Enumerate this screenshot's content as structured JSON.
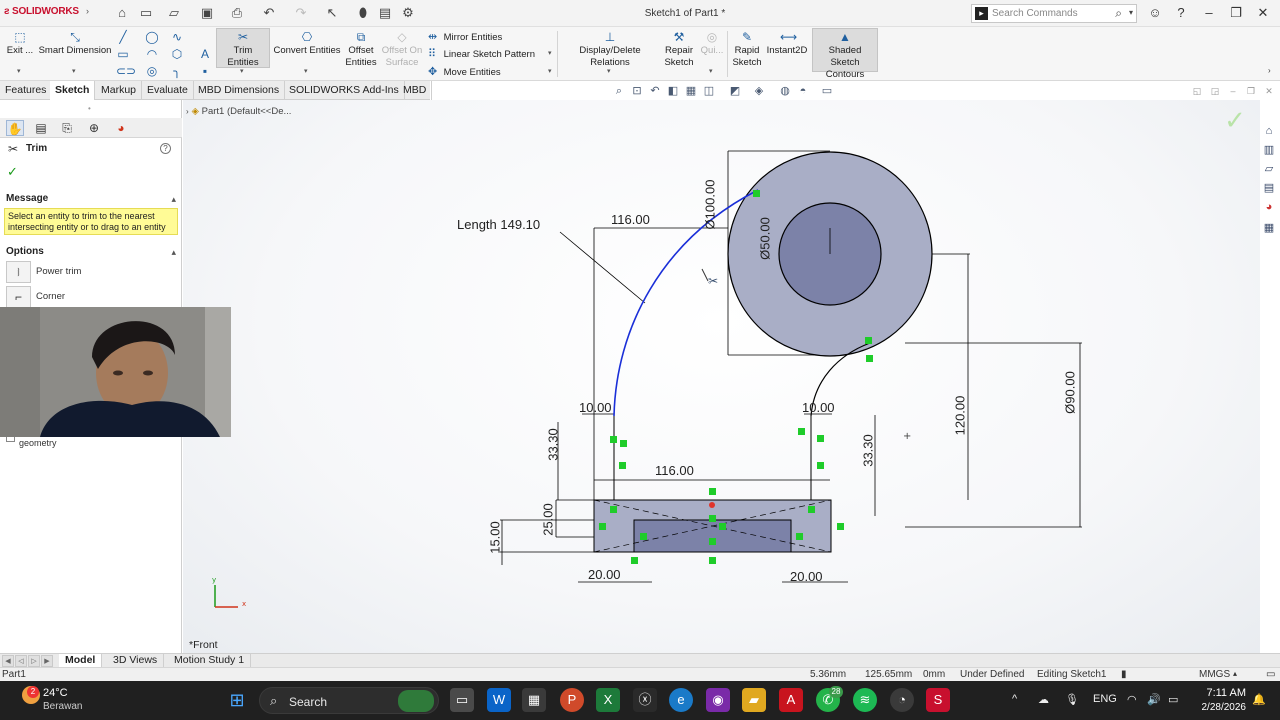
{
  "titlebar": {
    "app_brand": "SOLIDWORKS",
    "document_title": "Sketch1 of Part1 *",
    "search_placeholder": "Search Commands"
  },
  "ribbon": {
    "exit_label": "Exit ...",
    "smart_dimension": "Smart Dimension",
    "trim_entities": "Trim Entities",
    "convert_entities": "Convert Entities",
    "offset_entities_1": "Offset",
    "offset_entities_2": "Entities",
    "offset_on_surface_1": "Offset On",
    "offset_on_surface_2": "Surface",
    "mirror_entities": "Mirror Entities",
    "linear_sketch_pattern": "Linear Sketch Pattern",
    "move_entities": "Move Entities",
    "display_delete_relations": "Display/Delete Relations",
    "repair_sketch_1": "Repair",
    "repair_sketch_2": "Sketch",
    "quick_snaps": "Qui...",
    "rapid_sketch_1": "Rapid",
    "rapid_sketch_2": "Sketch",
    "instant2d": "Instant2D",
    "shaded_contours_1": "Shaded Sketch",
    "shaded_contours_2": "Contours"
  },
  "tabs": [
    "Features",
    "Sketch",
    "Markup",
    "Evaluate",
    "MBD Dimensions",
    "SOLIDWORKS Add-Ins",
    "MBD"
  ],
  "active_tab": "Sketch",
  "property_manager": {
    "title": "Trim",
    "message_header": "Message",
    "message_text": "Select an entity to trim to the nearest intersecting entity or to drag to an entity",
    "options_header": "Options",
    "options": [
      "Power trim",
      "Corner"
    ],
    "partial_label": "geometry"
  },
  "viewport": {
    "tree_item": "Part1 (Default<<De...",
    "view_label": "*Front",
    "dimensions": {
      "length_label": "Length 149.10",
      "top_width": "116.00",
      "dia_100": "Ø100.00",
      "dia_50": "Ø50.00",
      "dia_90": "Ø90.00",
      "height_120": "120.00",
      "left_offset": "10.00",
      "right_offset": "10.00",
      "left_height": "33.30",
      "right_height": "33.30",
      "mid_width": "116.00",
      "height_25": "25.00",
      "height_15": "15.00",
      "bottom_left": "20.00",
      "bottom_right": "20.00"
    }
  },
  "sheet_tabs": [
    "Model",
    "3D Views",
    "Motion Study 1"
  ],
  "active_sheet_tab": "Model",
  "statusbar": {
    "doc": "Part1",
    "x": "5.36mm",
    "y": "125.65mm",
    "z": "0mm",
    "state": "Under Defined",
    "editing": "Editing Sketch1",
    "units": "MMGS"
  },
  "taskbar": {
    "temperature": "24°C",
    "weather": "Berawan",
    "weather_badge": "2",
    "search_label": "Search",
    "whatsapp_badge": "28",
    "language": "ENG",
    "time": "7:11 AM",
    "date": "2/28/2026"
  },
  "colors": {
    "brand_red": "#c8102e",
    "sketch_blue": "#1a2fd8",
    "relation_green": "#1fcc2a",
    "shaded_fill": "#a9aec6",
    "inner_fill": "#7c82a8"
  }
}
